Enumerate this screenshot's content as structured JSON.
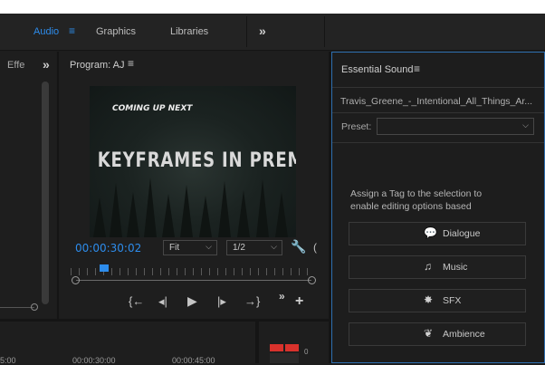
{
  "workspaces": {
    "tabs": [
      {
        "label": "Audio",
        "active": true
      },
      {
        "label": "Graphics",
        "active": false
      },
      {
        "label": "Libraries",
        "active": false
      }
    ],
    "more_label": "»"
  },
  "effects_panel": {
    "title": "Effe",
    "more_label": "»"
  },
  "program_monitor": {
    "title": "Program: AJ",
    "menu_icon": "hamburger-icon",
    "video": {
      "headline": "G KEYFRAMES IN PREMI",
      "subtitle": "COMING UP NEXT"
    },
    "timecode": "00:00:30:02",
    "fit": {
      "selected": "Fit"
    },
    "resolution": {
      "selected": "1/2"
    },
    "playhead_fraction": 0.14,
    "more_label": "»",
    "add_label": "+"
  },
  "essential_sound": {
    "title": "Essential Sound",
    "clip_name": "Travis_Greene_-_Intentional_All_Things_Ar...",
    "preset_label": "Preset:",
    "preset_value": "",
    "assign_text_line1": "Assign a Tag to the selection to",
    "assign_text_line2": "enable editing options based",
    "tags": [
      {
        "label": "Dialogue",
        "icon": "speech-bubble-icon"
      },
      {
        "label": "Music",
        "icon": "music-note-icon"
      },
      {
        "label": "SFX",
        "icon": "burst-icon"
      },
      {
        "label": "Ambience",
        "icon": "leaf-icon"
      }
    ]
  },
  "timeline": {
    "ruler_left": "5:00",
    "ruler_mid1": "00:00:30:00",
    "ruler_mid2": "00:00:45:00",
    "meter_label": "0"
  },
  "colors": {
    "accent": "#2d8ceb",
    "panel_border_active": "#2e6fb0",
    "meter_red": "#d9322c"
  }
}
